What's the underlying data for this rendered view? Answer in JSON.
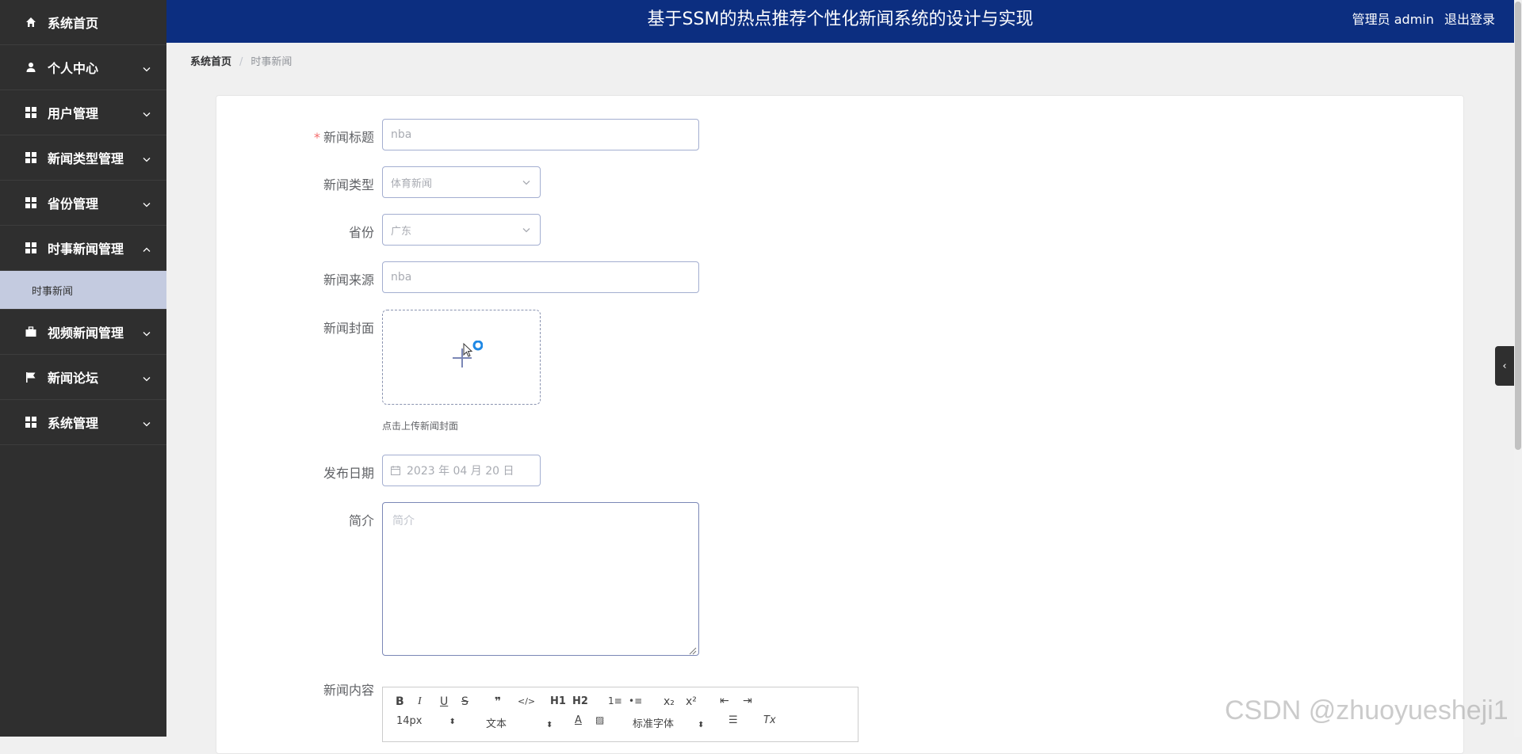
{
  "header": {
    "title": "基于SSM的热点推荐个性化新闻系统的设计与实现",
    "user": "管理员 admin",
    "logout": "退出登录"
  },
  "sidebar": {
    "items": [
      {
        "label": "系统首页",
        "icon": "home-icon"
      },
      {
        "label": "个人中心",
        "icon": "user-icon"
      },
      {
        "label": "用户管理",
        "icon": "grid-icon"
      },
      {
        "label": "新闻类型管理",
        "icon": "grid-icon"
      },
      {
        "label": "省份管理",
        "icon": "grid-icon"
      },
      {
        "label": "时事新闻管理",
        "icon": "grid-icon",
        "expanded": true
      },
      {
        "label": "视频新闻管理",
        "icon": "briefcase-icon"
      },
      {
        "label": "新闻论坛",
        "icon": "flag-icon"
      },
      {
        "label": "系统管理",
        "icon": "grid-icon"
      }
    ],
    "sub_item": "时事新闻"
  },
  "breadcrumb": {
    "home": "系统首页",
    "separator": "/",
    "current": "时事新闻"
  },
  "form": {
    "title_label": "新闻标题",
    "title_required": "*",
    "title_value": "nba",
    "type_label": "新闻类型",
    "type_value": "体育新闻",
    "province_label": "省份",
    "province_value": "广东",
    "source_label": "新闻来源",
    "source_value": "nba",
    "cover_label": "新闻封面",
    "cover_hint": "点击上传新闻封面",
    "date_label": "发布日期",
    "date_value": "2023 年 04 月 20 日",
    "intro_label": "简介",
    "intro_placeholder": "简介",
    "content_label": "新闻内容"
  },
  "editor": {
    "buttons": [
      "B",
      "I",
      "U",
      "S",
      "❞",
      "</>",
      "H1",
      "H2",
      "1≡",
      "•≡",
      "x₂",
      "x²",
      "⇤",
      "⇥"
    ],
    "font_size": "14px",
    "text_style": "文本",
    "font_family": "标准字体",
    "text_color_icon": "A",
    "clear_icon": "Tx"
  },
  "watermark": "CSDN @zhuoyueshejі1",
  "colors": {
    "header_bg": "#0c2e80",
    "sidebar_bg": "#2f2f2f",
    "active_sub_bg": "#c4cbe0"
  }
}
